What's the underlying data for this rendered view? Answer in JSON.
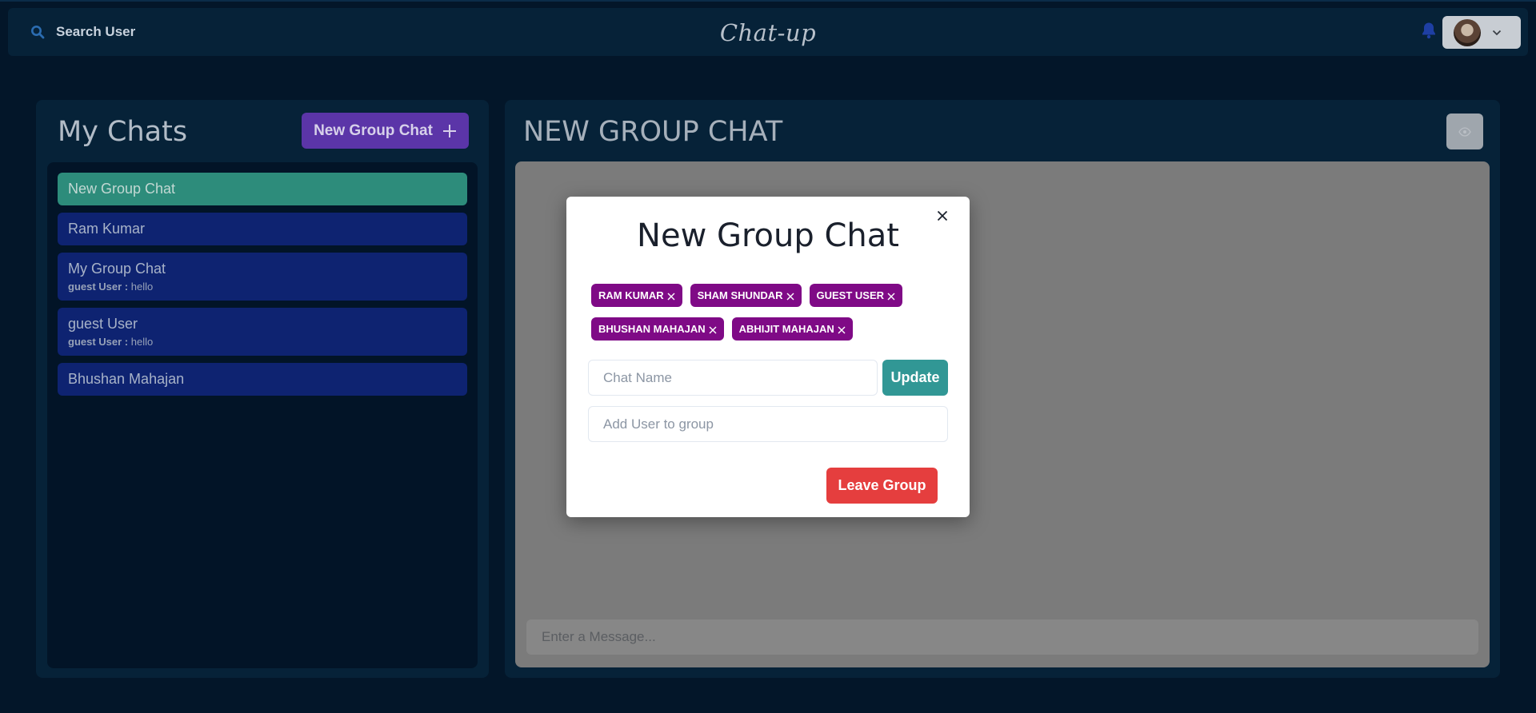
{
  "header": {
    "search_label": "Search User",
    "brand": "Chat-up",
    "icons": {
      "search": "search-icon",
      "bell": "bell-icon",
      "chevron": "chevron-down-icon"
    },
    "accent": "#2b6cb0"
  },
  "left_panel": {
    "title": "My Chats",
    "new_group_label": "New Group Chat",
    "chats": [
      {
        "name": "New Group Chat",
        "active": true
      },
      {
        "name": "Ram Kumar"
      },
      {
        "name": "My Group Chat",
        "preview_sender": "guest User :",
        "preview_text": "hello"
      },
      {
        "name": "guest User",
        "preview_sender": "guest User :",
        "preview_text": "hello"
      },
      {
        "name": "Bhushan Mahajan"
      }
    ]
  },
  "right_panel": {
    "title": "NEW GROUP CHAT",
    "message_placeholder": "Enter a Message..."
  },
  "modal": {
    "title": "New Group Chat",
    "members": [
      "RAM KUMAR",
      "SHAM SHUNDAR",
      "GUEST USER",
      "BHUSHAN MAHAJAN",
      "ABHIJIT MAHAJAN"
    ],
    "chat_name_placeholder": "Chat Name",
    "update_label": "Update",
    "add_user_placeholder": "Add User to group",
    "leave_label": "Leave Group",
    "colors": {
      "badge": "#7f0a86",
      "update": "#319795",
      "leave": "#e53e3e"
    }
  }
}
